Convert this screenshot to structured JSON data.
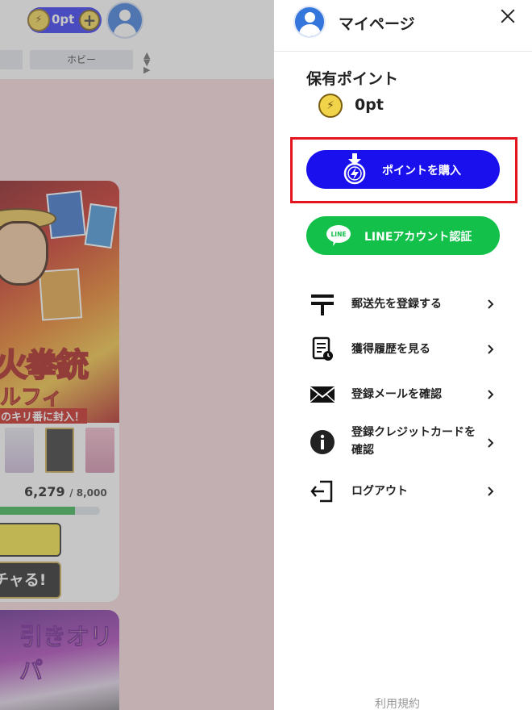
{
  "background": {
    "points_pill": {
      "value": "0pt",
      "coin_glyph": "⚡",
      "plus_glyph": "+"
    },
    "category_tab": "ホビー",
    "card": {
      "title_line1": "火拳銃",
      "title_line2": "ルフィ",
      "title_line3": "のキリ番に封入！",
      "progress_current": "6,279",
      "progress_total": "/ 8,000",
      "progress_ratio": 0.785,
      "gacha_label": "チャる!"
    },
    "card2": {
      "title": "引きオリパ"
    }
  },
  "drawer": {
    "title": "マイページ",
    "points_label": "保有ポイント",
    "points_value": "0pt",
    "coin_glyph": "⚡",
    "buy_button": "ポイントを購入",
    "line_button": "LINEアカウント認証",
    "line_logo_text": "LINE",
    "menu": [
      {
        "label": "郵送先を登録する",
        "icon": "postal-mark-icon"
      },
      {
        "label": "獲得履歴を見る",
        "icon": "history-document-icon"
      },
      {
        "label": "登録メールを確認",
        "icon": "mail-icon"
      },
      {
        "label": "登録クレジットカードを確認",
        "icon": "info-icon"
      },
      {
        "label": "ログアウト",
        "icon": "logout-icon"
      }
    ],
    "footer_link": "利用規約"
  },
  "colors": {
    "buy_button": "#1a10ee",
    "line_button": "#12c04a",
    "highlight": "#e4141e",
    "avatar": "#3576dd"
  }
}
